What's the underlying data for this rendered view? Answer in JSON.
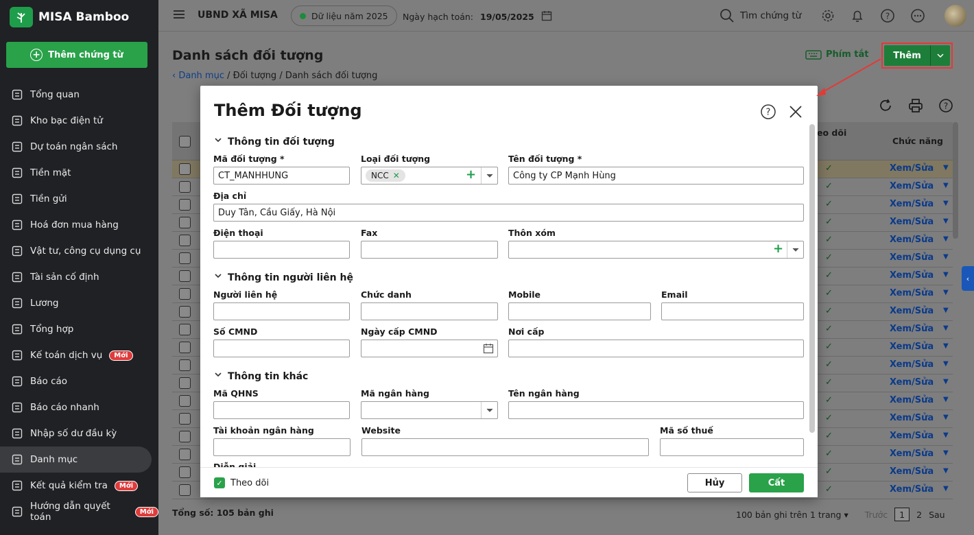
{
  "app": {
    "name": "MISA Bamboo",
    "add_voucher": "Thêm chứng từ"
  },
  "sidebar": {
    "items": [
      {
        "label": "Tổng quan",
        "icon": "chart-pie-icon"
      },
      {
        "label": "Kho bạc điện tử",
        "icon": "monitor-icon"
      },
      {
        "label": "Dự toán ngân sách",
        "icon": "budget-icon"
      },
      {
        "label": "Tiền mặt",
        "icon": "cash-icon"
      },
      {
        "label": "Tiền gửi",
        "icon": "deposit-icon"
      },
      {
        "label": "Hoá đơn mua hàng",
        "icon": "invoice-icon"
      },
      {
        "label": "Vật tư, công cụ dụng cụ",
        "icon": "tools-icon"
      },
      {
        "label": "Tài sản cố định",
        "icon": "building-icon"
      },
      {
        "label": "Lương",
        "icon": "salary-icon"
      },
      {
        "label": "Tổng hợp",
        "icon": "summary-icon"
      },
      {
        "label": "Kế toán dịch vụ",
        "icon": "service-icon",
        "badge": "Mới"
      },
      {
        "label": "Báo cáo",
        "icon": "report-icon"
      },
      {
        "label": "Báo cáo nhanh",
        "icon": "quick-report-icon"
      },
      {
        "label": "Nhập số dư đầu kỳ",
        "icon": "opening-balance-icon"
      },
      {
        "label": "Danh mục",
        "icon": "catalog-icon",
        "active": true
      },
      {
        "label": "Kết quả kiểm tra",
        "icon": "check-result-icon",
        "badge": "Mới"
      },
      {
        "label": "Hướng dẫn quyết toán",
        "icon": "guide-icon",
        "badge": "Mới"
      }
    ]
  },
  "topbar": {
    "org": "UBND XÃ MISA",
    "year_data": "Dữ liệu năm 2025",
    "posting_date_label": "Ngày hạch toán:",
    "posting_date": "19/05/2025",
    "search_placeholder": "Tìm chứng từ"
  },
  "page": {
    "title": "Danh sách đối tượng",
    "breadcrumb": {
      "link": "Danh mục",
      "rest": " / Đối tượng / Danh sách đối tượng"
    },
    "shortcut": "Phím tắt",
    "add_button": "Thêm",
    "columns": {
      "follow_partial": "eo dõi",
      "actions": "Chức năng"
    },
    "row_action": "Xem/Sửa",
    "row_count": 19,
    "total": "Tổng số: 105 bản ghi",
    "pager": {
      "per_page": "100 bản ghi trên 1 trang",
      "prev": "Trước",
      "page1": "1",
      "page2": "2",
      "next": "Sau"
    }
  },
  "modal": {
    "title": "Thêm Đối tượng",
    "sections": {
      "info": "Thông tin đối tượng",
      "contact": "Thông tin người liên hệ",
      "other": "Thông tin khác"
    },
    "fields": {
      "code_label": "Mã đối tượng *",
      "code_value": "CT_MANHHUNG",
      "type_label": "Loại đối tượng",
      "type_tag": "NCC",
      "name_label": "Tên đối tượng *",
      "name_value": "Công ty CP Mạnh Hùng",
      "address_label": "Địa chỉ",
      "address_value": "Duy Tân, Cầu Giấy, Hà Nội",
      "phone_label": "Điện thoại",
      "fax_label": "Fax",
      "hamlet_label": "Thôn xóm",
      "contact_person_label": "Người liên hệ",
      "title_label": "Chức danh",
      "mobile_label": "Mobile",
      "email_label": "Email",
      "id_label": "Số CMND",
      "id_date_label": "Ngày cấp CMND",
      "id_place_label": "Nơi cấp",
      "qhns_label": "Mã QHNS",
      "bank_code_label": "Mã ngân hàng",
      "bank_name_label": "Tên ngân hàng",
      "bank_account_label": "Tài khoản ngân hàng",
      "website_label": "Website",
      "tax_label": "Mã số thuế",
      "note_label": "Diễn giải"
    },
    "follow_label": "Theo dõi",
    "cancel": "Hủy",
    "save": "Cất"
  },
  "colors": {
    "green": "#29a24a",
    "dark_green": "#1d7e3a",
    "highlight": "#e53935",
    "sidebar_bg": "#1f2124"
  }
}
